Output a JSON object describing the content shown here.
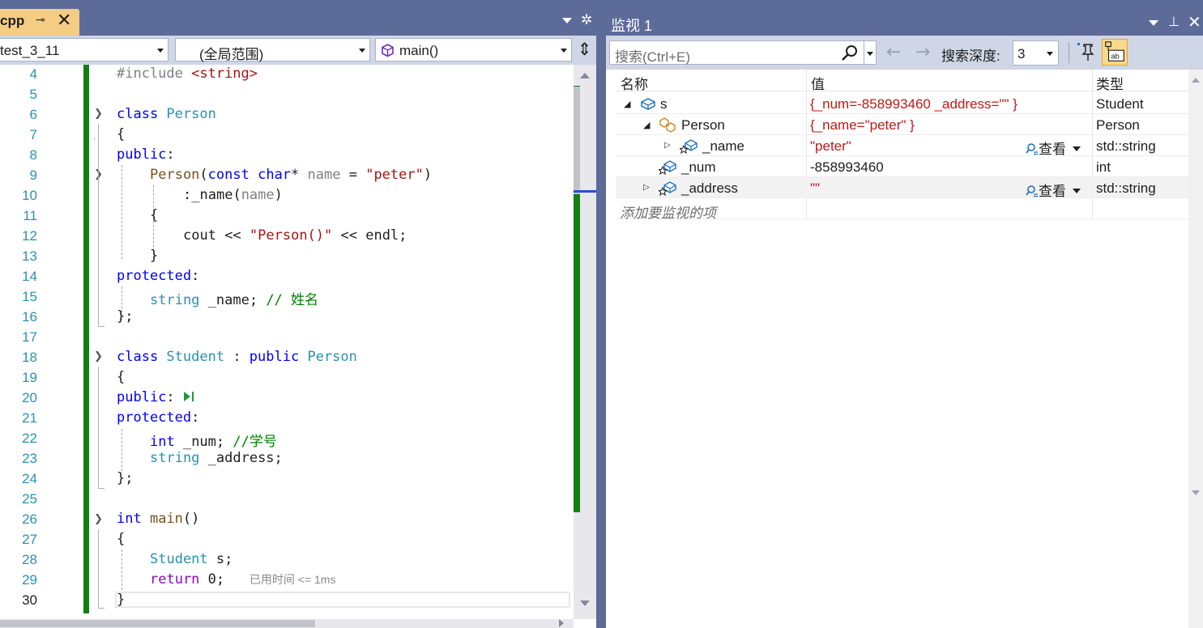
{
  "editor": {
    "tab": {
      "name": "cpp",
      "pin_glyph": "⊸",
      "close_glyph": "✕"
    },
    "nav": {
      "project": "test_3_11",
      "scope": "(全局范围)",
      "member": "main()"
    },
    "lines": [
      "4",
      "5",
      "6",
      "7",
      "8",
      "9",
      "10",
      "11",
      "12",
      "13",
      "14",
      "15",
      "16",
      "17",
      "18",
      "19",
      "20",
      "21",
      "22",
      "23",
      "24",
      "25",
      "26",
      "27",
      "28",
      "29",
      "30"
    ],
    "code": {
      "l4a": "#include ",
      "l4b": "<string>",
      "l6a": "class ",
      "l6b": "Person",
      "l7": "{",
      "l8a": "public",
      "l8b": ":",
      "l9a": "Person",
      "l9b": "(",
      "l9c": "const ",
      "l9d": "char",
      "l9e": "* ",
      "l9f": "name",
      "l9g": " = ",
      "l9h": "\"peter\"",
      "l9i": ")",
      "l10a": ":",
      "l10b": "_name",
      "l10c": "(",
      "l10d": "name",
      "l10e": ")",
      "l11": "{",
      "l12a": "cout",
      "l12b": " << ",
      "l12c": "\"Person()\"",
      "l12d": " << ",
      "l12e": "endl",
      "l12f": ";",
      "l13": "}",
      "l14a": "protected",
      "l14b": ":",
      "l15a": "string",
      "l15b": " _name; ",
      "l15c": "// 姓名",
      "l16": "};",
      "l18a": "class ",
      "l18b": "Student",
      "l18c": " : ",
      "l18d": "public ",
      "l18e": "Person",
      "l19": "{",
      "l20a": "public",
      "l20b": ":",
      "l21a": "protected",
      "l21b": ":",
      "l22a": "int",
      "l22b": " _num; ",
      "l22c": "//学号",
      "l23a": "string",
      "l23b": " _address;",
      "l24": "};",
      "l26a": "int ",
      "l26b": "main",
      "l26c": "()",
      "l27": "{",
      "l28a": "Student",
      "l28b": " s;",
      "l29a": "return ",
      "l29b": "0;",
      "l29c": "已用时间 <= 1ms",
      "l30": "}"
    }
  },
  "watch": {
    "title": "监视 1",
    "search_placeholder": "搜索(Ctrl+E)",
    "depth_label": "搜索深度:",
    "depth_value": "3",
    "columns": {
      "name": "名称",
      "value": "值",
      "type": "类型"
    },
    "rows": [
      {
        "name": "s",
        "value": "{_num=-858993460 _address=\"\" }",
        "type": "Student"
      },
      {
        "name": "Person",
        "value": "{_name=\"peter\" }",
        "type": "Person"
      },
      {
        "name": "_name",
        "value": "\"peter\"",
        "type": "std::string",
        "viewer": "查看"
      },
      {
        "name": "_num",
        "value": "-858993460",
        "type": "int"
      },
      {
        "name": "_address",
        "value": "\"\"",
        "type": "std::string",
        "viewer": "查看"
      }
    ],
    "add_item": "添加要监视的项"
  },
  "colors": {
    "accent": "#5d6b99",
    "breakpoint_green": "#108010",
    "value_changed": "#c01818",
    "keyword": "#0000ff",
    "type": "#2b91af"
  }
}
